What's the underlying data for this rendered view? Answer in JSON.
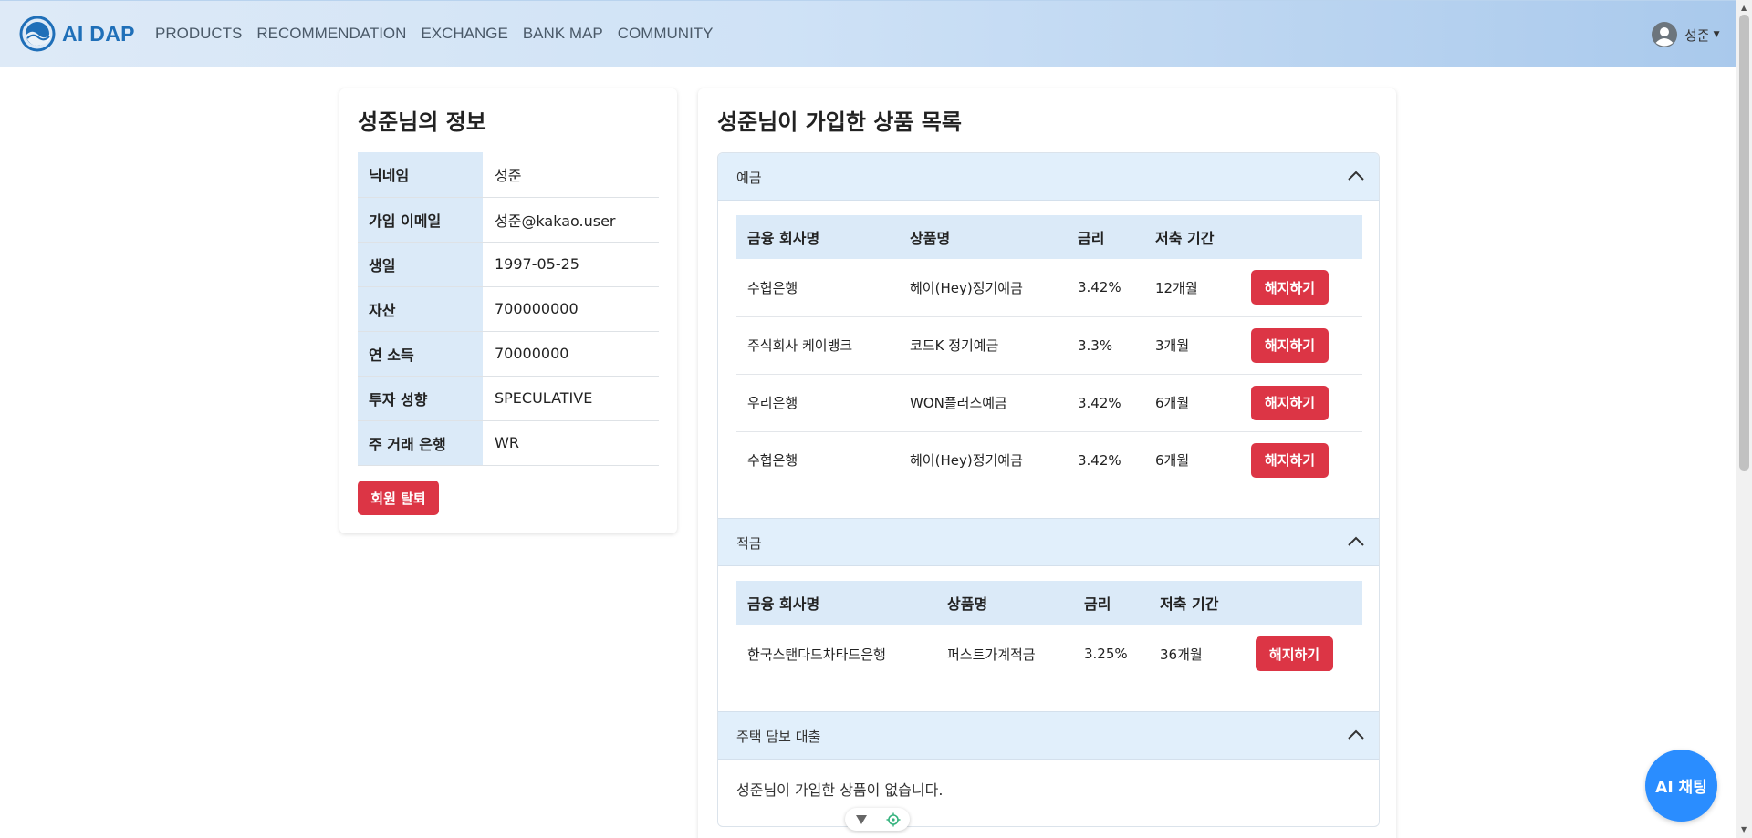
{
  "brand": {
    "name": "AI DAP",
    "logo_icon": "wave-logo-icon"
  },
  "nav": {
    "items": [
      "PRODUCTS",
      "RECOMMENDATION",
      "EXCHANGE",
      "BANK MAP",
      "COMMUNITY"
    ]
  },
  "user": {
    "name": "성준",
    "avatar_icon": "user-avatar-icon"
  },
  "profile": {
    "title": "성준님의 정보",
    "rows": [
      {
        "label": "닉네임",
        "value": "성준"
      },
      {
        "label": "가입 이메일",
        "value": "성준@kakao.user"
      },
      {
        "label": "생일",
        "value": "1997-05-25"
      },
      {
        "label": "자산",
        "value": "700000000"
      },
      {
        "label": "연 소득",
        "value": "70000000"
      },
      {
        "label": "투자 성향",
        "value": "SPECULATIVE"
      },
      {
        "label": "주 거래 은행",
        "value": "WR"
      }
    ],
    "withdraw_label": "회원 탈퇴"
  },
  "products": {
    "title": "성준님이 가입한 상품 목록",
    "sections": [
      {
        "label": "예금",
        "columns": [
          "금융 회사명",
          "상품명",
          "금리",
          "저축 기간"
        ],
        "rows": [
          {
            "company": "수협은행",
            "product": "헤이(Hey)정기예금",
            "rate": "3.42%",
            "period": "12개월",
            "action": "해지하기"
          },
          {
            "company": "주식회사 케이뱅크",
            "product": "코드K 정기예금",
            "rate": "3.3%",
            "period": "3개월",
            "action": "해지하기"
          },
          {
            "company": "우리은행",
            "product": "WON플러스예금",
            "rate": "3.42%",
            "period": "6개월",
            "action": "해지하기"
          },
          {
            "company": "수협은행",
            "product": "헤이(Hey)정기예금",
            "rate": "3.42%",
            "period": "6개월",
            "action": "해지하기"
          }
        ]
      },
      {
        "label": "적금",
        "columns": [
          "금융 회사명",
          "상품명",
          "금리",
          "저축 기간"
        ],
        "rows": [
          {
            "company": "한국스탠다드차타드은행",
            "product": "퍼스트가계적금",
            "rate": "3.25%",
            "period": "36개월",
            "action": "해지하기"
          }
        ]
      },
      {
        "label": "주택 담보 대출",
        "empty_message": "성준님이 가입한 상품이 없습니다."
      }
    ]
  },
  "chat": {
    "label": "AI 채팅"
  },
  "colors": {
    "accent": "#2a8dff",
    "danger": "#dc3545",
    "header_bg": "#dbeaf8"
  }
}
